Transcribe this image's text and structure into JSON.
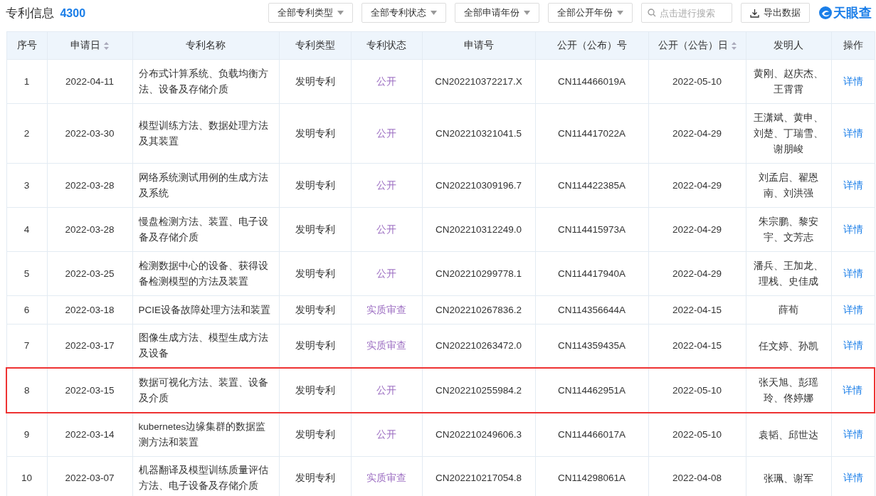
{
  "header": {
    "title": "专利信息",
    "count": "4300"
  },
  "filters": [
    {
      "label": "全部专利类型"
    },
    {
      "label": "全部专利状态"
    },
    {
      "label": "全部申请年份"
    },
    {
      "label": "全部公开年份"
    }
  ],
  "search": {
    "placeholder": "点击进行搜索"
  },
  "export_button": {
    "label": "导出数据"
  },
  "logo": {
    "text": "天眼查"
  },
  "table": {
    "columns": [
      {
        "label": "序号",
        "sortable": false
      },
      {
        "label": "申请日",
        "sortable": true
      },
      {
        "label": "专利名称",
        "sortable": false
      },
      {
        "label": "专利类型",
        "sortable": false
      },
      {
        "label": "专利状态",
        "sortable": false
      },
      {
        "label": "申请号",
        "sortable": false
      },
      {
        "label": "公开（公布）号",
        "sortable": false
      },
      {
        "label": "公开（公告）日",
        "sortable": true
      },
      {
        "label": "发明人",
        "sortable": false
      },
      {
        "label": "操作",
        "sortable": false
      }
    ],
    "rows": [
      {
        "index": "1",
        "apply_date": "2022-04-11",
        "name": "分布式计算系统、负载均衡方法、设备及存储介质",
        "type": "发明专利",
        "status": "公开",
        "apply_no": "CN202210372217.X",
        "pub_no": "CN114466019A",
        "pub_date": "2022-05-10",
        "inventors": "黄刚、赵庆杰、王霄霄",
        "action": "详情",
        "highlighted": false
      },
      {
        "index": "2",
        "apply_date": "2022-03-30",
        "name": "模型训练方法、数据处理方法及其装置",
        "type": "发明专利",
        "status": "公开",
        "apply_no": "CN202210321041.5",
        "pub_no": "CN114417022A",
        "pub_date": "2022-04-29",
        "inventors": "王潇斌、黄申、刘楚、丁瑞雪、谢朋峻",
        "action": "详情",
        "highlighted": false
      },
      {
        "index": "3",
        "apply_date": "2022-03-28",
        "name": "网络系统测试用例的生成方法及系统",
        "type": "发明专利",
        "status": "公开",
        "apply_no": "CN202210309196.7",
        "pub_no": "CN114422385A",
        "pub_date": "2022-04-29",
        "inventors": "刘孟启、翟恩南、刘洪强",
        "action": "详情",
        "highlighted": false
      },
      {
        "index": "4",
        "apply_date": "2022-03-28",
        "name": "慢盘检测方法、装置、电子设备及存储介质",
        "type": "发明专利",
        "status": "公开",
        "apply_no": "CN202210312249.0",
        "pub_no": "CN114415973A",
        "pub_date": "2022-04-29",
        "inventors": "朱宗鹏、黎安宇、文芳志",
        "action": "详情",
        "highlighted": false
      },
      {
        "index": "5",
        "apply_date": "2022-03-25",
        "name": "检测数据中心的设备、获得设备检测模型的方法及装置",
        "type": "发明专利",
        "status": "公开",
        "apply_no": "CN202210299778.1",
        "pub_no": "CN114417940A",
        "pub_date": "2022-04-29",
        "inventors": "潘兵、王加龙、理栈、史佳成",
        "action": "详情",
        "highlighted": false
      },
      {
        "index": "6",
        "apply_date": "2022-03-18",
        "name": "PCIE设备故障处理方法和装置",
        "type": "发明专利",
        "status": "实质审查",
        "apply_no": "CN202210267836.2",
        "pub_no": "CN114356644A",
        "pub_date": "2022-04-15",
        "inventors": "薛荀",
        "action": "详情",
        "highlighted": false
      },
      {
        "index": "7",
        "apply_date": "2022-03-17",
        "name": "图像生成方法、模型生成方法及设备",
        "type": "发明专利",
        "status": "实质审查",
        "apply_no": "CN202210263472.0",
        "pub_no": "CN114359435A",
        "pub_date": "2022-04-15",
        "inventors": "任文婷、孙凯",
        "action": "详情",
        "highlighted": false
      },
      {
        "index": "8",
        "apply_date": "2022-03-15",
        "name": "数据可视化方法、装置、设备及介质",
        "type": "发明专利",
        "status": "公开",
        "apply_no": "CN202210255984.2",
        "pub_no": "CN114462951A",
        "pub_date": "2022-05-10",
        "inventors": "张天旭、彭瑶玲、佟婷娜",
        "action": "详情",
        "highlighted": true
      },
      {
        "index": "9",
        "apply_date": "2022-03-14",
        "name": "kubernetes边缘集群的数据监测方法和装置",
        "type": "发明专利",
        "status": "公开",
        "apply_no": "CN202210249606.3",
        "pub_no": "CN114466017A",
        "pub_date": "2022-05-10",
        "inventors": "袁韬、邱世达",
        "action": "详情",
        "highlighted": false
      },
      {
        "index": "10",
        "apply_date": "2022-03-07",
        "name": "机器翻译及模型训练质量评估方法、电子设备及存储介质",
        "type": "发明专利",
        "status": "实质审查",
        "apply_no": "CN202210217054.8",
        "pub_no": "CN114298061A",
        "pub_date": "2022-04-08",
        "inventors": "张珮、谢军",
        "action": "详情",
        "highlighted": false
      }
    ]
  }
}
